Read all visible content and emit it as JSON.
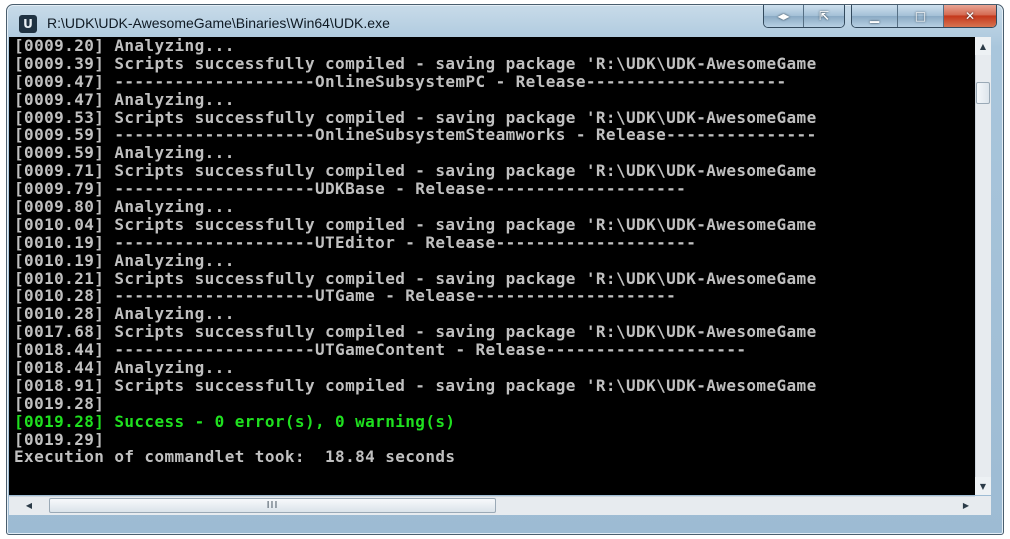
{
  "window": {
    "title": "R:\\UDK\\UDK-AwesomeGame\\Binaries\\Win64\\UDK.exe",
    "icon": "udk-u-icon",
    "icon_letter": "U",
    "buttons": {
      "extra1": "◂▸",
      "extra2": "⇱",
      "minimize": "▁",
      "maximize": "□",
      "close": "✕"
    }
  },
  "console": {
    "background": "#000000",
    "text_color": "#c0c0c0",
    "success_color": "#1fe01f",
    "lines": [
      {
        "text": "[0009.20] Analyzing...",
        "type": "normal"
      },
      {
        "text": "[0009.39] Scripts successfully compiled - saving package 'R:\\UDK\\UDK-AwesomeGame",
        "type": "normal"
      },
      {
        "text": "[0009.47] --------------------OnlineSubsystemPC - Release--------------------",
        "type": "normal"
      },
      {
        "text": "[0009.47] Analyzing...",
        "type": "normal"
      },
      {
        "text": "[0009.53] Scripts successfully compiled - saving package 'R:\\UDK\\UDK-AwesomeGame",
        "type": "normal"
      },
      {
        "text": "[0009.59] --------------------OnlineSubsystemSteamworks - Release---------------",
        "type": "normal"
      },
      {
        "text": "[0009.59] Analyzing...",
        "type": "normal"
      },
      {
        "text": "[0009.71] Scripts successfully compiled - saving package 'R:\\UDK\\UDK-AwesomeGame",
        "type": "normal"
      },
      {
        "text": "[0009.79] --------------------UDKBase - Release--------------------",
        "type": "normal"
      },
      {
        "text": "[0009.80] Analyzing...",
        "type": "normal"
      },
      {
        "text": "[0010.04] Scripts successfully compiled - saving package 'R:\\UDK\\UDK-AwesomeGame",
        "type": "normal"
      },
      {
        "text": "[0010.19] --------------------UTEditor - Release--------------------",
        "type": "normal"
      },
      {
        "text": "[0010.19] Analyzing...",
        "type": "normal"
      },
      {
        "text": "[0010.21] Scripts successfully compiled - saving package 'R:\\UDK\\UDK-AwesomeGame",
        "type": "normal"
      },
      {
        "text": "[0010.28] --------------------UTGame - Release--------------------",
        "type": "normal"
      },
      {
        "text": "[0010.28] Analyzing...",
        "type": "normal"
      },
      {
        "text": "[0017.68] Scripts successfully compiled - saving package 'R:\\UDK\\UDK-AwesomeGame",
        "type": "normal"
      },
      {
        "text": "[0018.44] --------------------UTGameContent - Release--------------------",
        "type": "normal"
      },
      {
        "text": "[0018.44] Analyzing...",
        "type": "normal"
      },
      {
        "text": "[0018.91] Scripts successfully compiled - saving package 'R:\\UDK\\UDK-AwesomeGame",
        "type": "normal"
      },
      {
        "text": "[0019.28]",
        "type": "normal"
      },
      {
        "text": "[0019.28] Success - 0 error(s), 0 warning(s)",
        "type": "success"
      },
      {
        "text": "[0019.29]",
        "type": "normal"
      },
      {
        "text": "Execution of commandlet took:  18.84 seconds",
        "type": "normal"
      }
    ]
  },
  "scrollbars": {
    "up_arrow": "▲",
    "down_arrow": "▼",
    "left_arrow": "◀",
    "right_arrow": "▶",
    "thumb_grip": "III"
  }
}
